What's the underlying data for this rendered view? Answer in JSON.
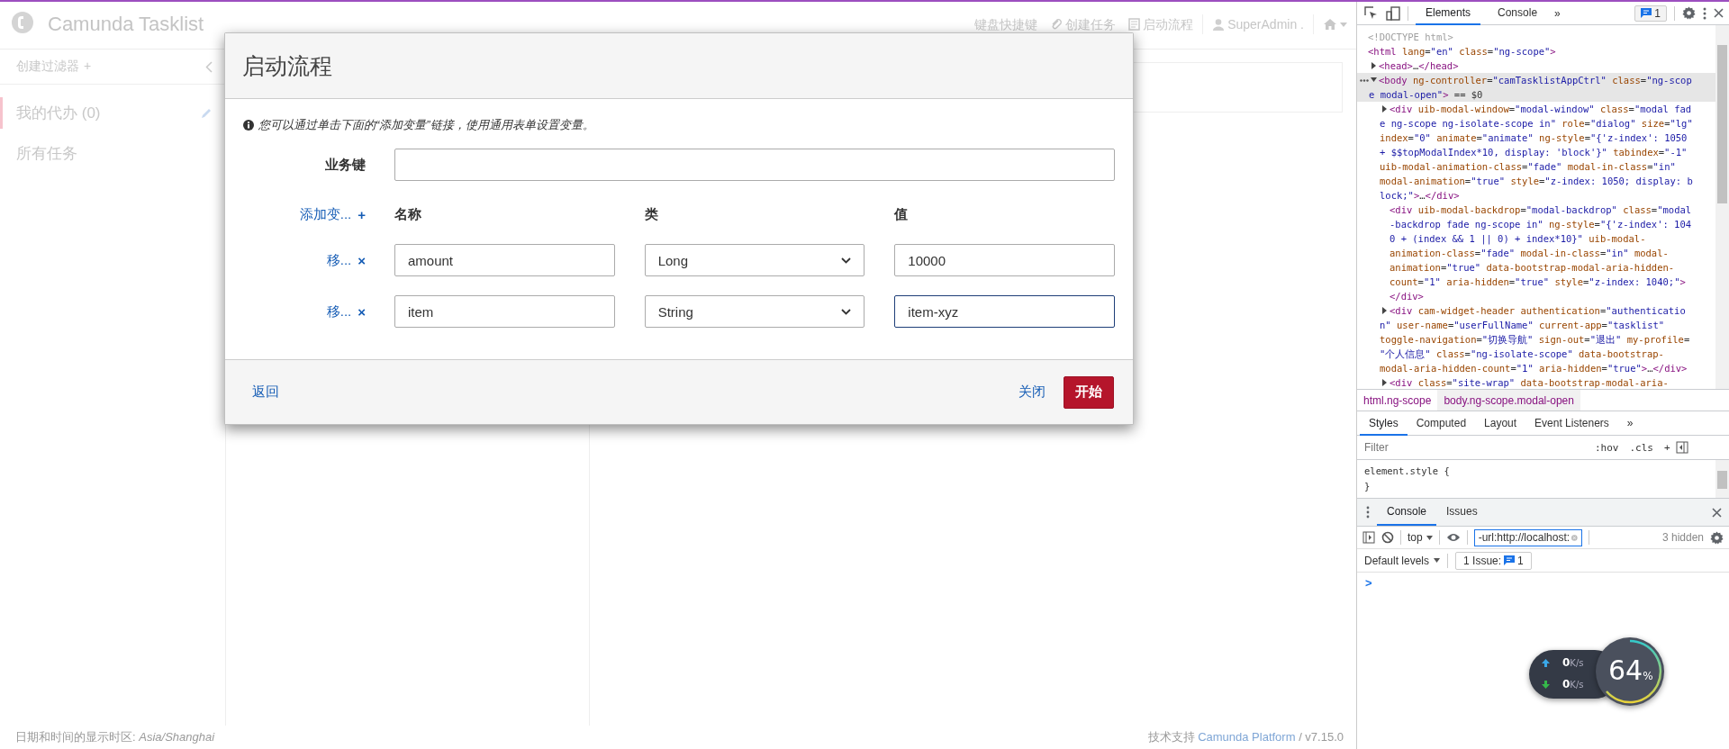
{
  "app": {
    "title": "Camunda Tasklist",
    "nav": [
      {
        "kind": "plain",
        "label": "键盘快捷键"
      },
      {
        "kind": "attach",
        "label": "创建任务"
      },
      {
        "kind": "form",
        "label": "启动流程"
      },
      {
        "kind": "user",
        "label": "SuperAdmin ."
      },
      {
        "kind": "home"
      }
    ],
    "sidebar": {
      "create_filter": {
        "label": "创建过滤器",
        "icon": "+"
      },
      "filters": [
        {
          "label": "我的代办 (0)",
          "selected": true
        },
        {
          "label": "所有任务",
          "selected": false
        }
      ]
    },
    "footer": {
      "timezone": "日期和时间的显示时区: *Asia/Shanghai*",
      "credits": {
        "prefix": "技术支持",
        "link": "Camunda Platform",
        "suffix": "/ v7.15.0"
      }
    }
  },
  "modal": {
    "title": "启动流程",
    "info": "您可以通过单击下面的“添加变量”链接，使用通用表单设置变量。",
    "business_key_label": "业务键",
    "add_variable": {
      "label": "添加变...",
      "icon": "+"
    },
    "columns": [
      "名称",
      "类",
      "值"
    ],
    "variables": [
      {
        "remove": {
          "label": "移...",
          "icon": "×"
        },
        "name": "amount",
        "type": "Long",
        "value": "10000",
        "focused": false
      },
      {
        "remove": {
          "label": "移...",
          "icon": "×"
        },
        "name": "item",
        "type": "String",
        "value": "item-xyz",
        "focused": true
      }
    ],
    "back": "返回",
    "close": "关闭",
    "start": "开始"
  },
  "devtools": {
    "tabs": [
      {
        "label": "Elements",
        "selected": true
      },
      {
        "label": "Console",
        "selected": false
      }
    ],
    "more": "»",
    "issues_count": "1",
    "tree": [
      {
        "lines": [
          "<!DOCTYPE html>"
        ],
        "selected": false
      },
      {
        "lines": [
          "<html lang=\"en\" class=\"ng-scope\">"
        ],
        "selected": false,
        "children": [
          {
            "lines": [
              "<head>…</head>"
            ],
            "expanded": false,
            "selected": false
          },
          {
            "lines": [
              "<body ng-controller=\"camTasklistAppCtrl\" class=\"ng-scop",
              "e modal-open\"> == $0"
            ],
            "expanded": true,
            "selected": true,
            "children": [
              {
                "lines": [
                  "<div uib-modal-window=\"modal-window\" class=\"modal fad",
                  "e ng-scope ng-isolate-scope in\" role=\"dialog\" size=\"lg\"",
                  "index=\"0\" animate=\"animate\" ng-style=\"{'z-index': 1050",
                  "+ $$topModalIndex*10, display: 'block'}\" tabindex=\"-1\"",
                  "uib-modal-animation-class=\"fade\" modal-in-class=\"in\"",
                  "modal-animation=\"true\" style=\"z-index: 1050; display: b",
                  "lock;\">…</div>"
                ],
                "expanded": false,
                "selected": false
              },
              {
                "lines": [
                  "<div uib-modal-backdrop=\"modal-backdrop\" class=\"modal",
                  "-backdrop fade ng-scope in\" ng-style=\"{'z-index': 104",
                  "0 + (index && 1 || 0) + index*10}\" uib-modal-",
                  "animation-class=\"fade\" modal-in-class=\"in\" modal-",
                  "animation=\"true\" data-bootstrap-modal-aria-hidden-",
                  "count=\"1\" aria-hidden=\"true\" style=\"z-index: 1040;\">",
                  "</div>"
                ],
                "selected": false
              },
              {
                "lines": [
                  "<div cam-widget-header authentication=\"authenticatio",
                  "n\" user-name=\"userFullName\" current-app=\"tasklist\"",
                  "toggle-navigation=\"切换导航\" sign-out=\"退出\" my-profile=",
                  "\"个人信息\" class=\"ng-isolate-scope\" data-bootstrap-",
                  "modal-aria-hidden-count=\"1\" aria-hidden=\"true\">…</div>"
                ],
                "expanded": false,
                "selected": false
              },
              {
                "lines": [
                  "<div class=\"site-wrap\" data-bootstrap-modal-aria-"
                ],
                "expanded": false,
                "selected": false
              }
            ]
          }
        ]
      }
    ],
    "breadcrumbs": [
      {
        "label": "html.ng-scope",
        "selected": false
      },
      {
        "label": "body.ng-scope.modal-open",
        "selected": true
      }
    ],
    "style_tabs": [
      {
        "label": "Styles",
        "selected": true
      },
      {
        "label": "Computed",
        "selected": false
      },
      {
        "label": "Layout",
        "selected": false
      },
      {
        "label": "Event Listeners",
        "selected": false
      }
    ],
    "style_more": "»",
    "filter_placeholder": "Filter",
    "hov": ":hov",
    "cls": ".cls",
    "add": "+",
    "style_rule": [
      "element.style {",
      "}"
    ],
    "drawer_tabs": [
      {
        "label": "Console",
        "selected": true
      },
      {
        "label": "Issues",
        "selected": false
      }
    ],
    "context": "top",
    "console_filter": "-url:http://localhost:",
    "hidden": "3 hidden",
    "levels": "Default levels",
    "issue_label": "1 Issue:",
    "issue_count": "1",
    "prompt": ">"
  },
  "net_monitor": {
    "upload": "0",
    "upload_unit": "K/s",
    "download": "0",
    "download_unit": "K/s",
    "value": "64",
    "unit": "%"
  }
}
